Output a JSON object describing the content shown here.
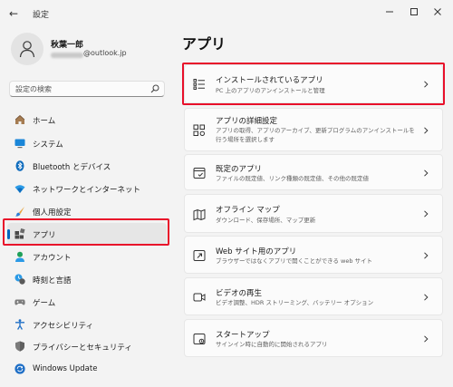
{
  "window": {
    "title": "設定",
    "back_icon": "arrow-left-icon"
  },
  "user": {
    "name": "秋葉一郎",
    "email_suffix": "@outlook.jp"
  },
  "search": {
    "placeholder": "設定の検索"
  },
  "sidebar": {
    "items": [
      {
        "label": "ホーム",
        "icon": "home-icon"
      },
      {
        "label": "システム",
        "icon": "system-icon"
      },
      {
        "label": "Bluetooth とデバイス",
        "icon": "bluetooth-icon"
      },
      {
        "label": "ネットワークとインターネット",
        "icon": "wifi-icon"
      },
      {
        "label": "個人用設定",
        "icon": "brush-icon"
      },
      {
        "label": "アプリ",
        "icon": "apps-icon",
        "selected": true
      },
      {
        "label": "アカウント",
        "icon": "account-icon"
      },
      {
        "label": "時刻と言語",
        "icon": "time-language-icon"
      },
      {
        "label": "ゲーム",
        "icon": "gamepad-icon"
      },
      {
        "label": "アクセシビリティ",
        "icon": "accessibility-icon"
      },
      {
        "label": "プライバシーとセキュリティ",
        "icon": "shield-icon"
      },
      {
        "label": "Windows Update",
        "icon": "windows-update-icon"
      }
    ]
  },
  "main": {
    "title": "アプリ",
    "cards": [
      {
        "title": "インストールされているアプリ",
        "subtitle": "PC 上のアプリのアンインストールと管理",
        "icon": "list-icon"
      },
      {
        "title": "アプリの詳細設定",
        "subtitle": "アプリの取得、アプリのアーカイブ、更新プログラムのアンインストールを行う場所を選択します",
        "icon": "app-settings-icon"
      },
      {
        "title": "既定のアプリ",
        "subtitle": "ファイルの既定値、リンク種類の既定値、その他の既定値",
        "icon": "default-apps-icon"
      },
      {
        "title": "オフライン マップ",
        "subtitle": "ダウンロード、保存場所、マップ更新",
        "icon": "map-icon"
      },
      {
        "title": "Web サイト用のアプリ",
        "subtitle": "ブラウザーではなくアプリで開くことができる web サイト",
        "icon": "web-apps-icon"
      },
      {
        "title": "ビデオの再生",
        "subtitle": "ビデオ調整、HDR ストリーミング、バッテリー オプション",
        "icon": "video-icon"
      },
      {
        "title": "スタートアップ",
        "subtitle": "サインイン時に自動的に開始されるアプリ",
        "icon": "startup-icon"
      }
    ]
  },
  "colors": {
    "accent": "#0067c0",
    "highlight": "#e8102a",
    "background": "#f3f3f3",
    "card": "#fbfbfb"
  }
}
